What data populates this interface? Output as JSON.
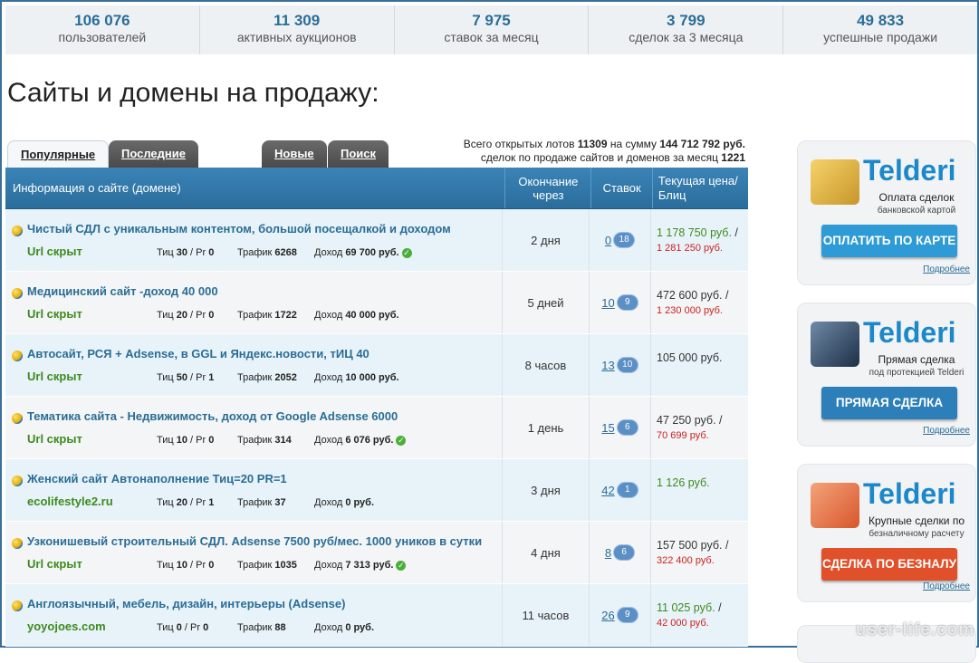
{
  "stats": [
    {
      "num": "106 076",
      "label": "пользователей"
    },
    {
      "num": "11 309",
      "label": "активных аукционов"
    },
    {
      "num": "7 975",
      "label": "ставок за месяц"
    },
    {
      "num": "3 799",
      "label": "сделок за 3 месяца"
    },
    {
      "num": "49 833",
      "label": "успешные продажи"
    }
  ],
  "page_title": "Сайты и домены на продажу:",
  "tabs": [
    {
      "label": "Популярные",
      "active": true
    },
    {
      "label": "Последние активные"
    },
    {
      "label": "Новые"
    },
    {
      "label": "Поиск"
    }
  ],
  "totals": {
    "line1_prefix": "Всего открытых лотов ",
    "lots": "11309",
    "line1_mid": " на сумму ",
    "sum": "144 712 792 руб.",
    "line2_prefix": "сделок по продаже сайтов и доменов за месяц ",
    "deals": "1221"
  },
  "table": {
    "headers": {
      "info": "Информация о сайте (домене)",
      "end": "Окончание через",
      "bids": "Ставок",
      "price": "Текущая цена/Блиц"
    },
    "rows": [
      {
        "title": "Чистый СДЛ с уникальным контентом, большой посещалкой и доходом",
        "site": "Url скрыт",
        "tic": "30",
        "pr": "0",
        "traffic": "6268",
        "income": "69 700 руб.",
        "verified": true,
        "end": "2 дня",
        "bids": "0",
        "bubble": "18",
        "price": "1 178 750 руб.",
        "sep": "/",
        "blitz": "1 281 250 руб."
      },
      {
        "title": "Медицинский сайт -доход 40 000",
        "site": "Url скрыт",
        "tic": "20",
        "pr": "0",
        "traffic": "1722",
        "income": "40 000 руб.",
        "verified": false,
        "end": "5 дней",
        "bids": "10",
        "bubble": "9",
        "price": "472 600 руб.",
        "sep": "/",
        "blitz": "1 230 000 руб."
      },
      {
        "title": "Автосайт, РСЯ + Adsense, в GGL и Яндекс.новости, тИЦ 40",
        "site": "Url скрыт",
        "tic": "50",
        "pr": "1",
        "traffic": "2052",
        "income": "10 000 руб.",
        "verified": false,
        "end": "8 часов",
        "bids": "13",
        "bubble": "10",
        "price": "105 000 руб.",
        "sep": "",
        "blitz": ""
      },
      {
        "title": "Тематика сайта - Недвижимость, доход от Google Adsense 6000",
        "site": "Url скрыт",
        "tic": "10",
        "pr": "0",
        "traffic": "314",
        "income": "6 076 руб.",
        "verified": true,
        "end": "1 день",
        "bids": "15",
        "bubble": "6",
        "price": "47 250 руб.",
        "sep": "/",
        "blitz": "70 699 руб."
      },
      {
        "title": "Женский сайт Автонаполнение Тиц=20 PR=1",
        "site": "ecolifestyle2.ru",
        "tic": "20",
        "pr": "1",
        "traffic": "37",
        "income": "0 руб.",
        "verified": false,
        "end": "3 дня",
        "bids": "42",
        "bubble": "1",
        "price": "1 126 руб.",
        "sep": "",
        "blitz": ""
      },
      {
        "title": "Узконишевый строительный СДЛ. Adsense 7500 руб/мес. 1000 уников в сутки",
        "site": "Url скрыт",
        "tic": "10",
        "pr": "0",
        "traffic": "1035",
        "income": "7 313 руб.",
        "verified": true,
        "end": "4 дня",
        "bids": "8",
        "bubble": "6",
        "price": "157 500 руб.",
        "sep": "/",
        "blitz": "322 400 руб."
      },
      {
        "title": "Англоязычный, мебель, дизайн, интерьеры (Adsense)",
        "site": "yoyojoes.com",
        "tic": "0",
        "pr": "0",
        "traffic": "88",
        "income": "0 руб.",
        "verified": false,
        "end": "11 часов",
        "bids": "26",
        "bubble": "9",
        "price": "11 025 руб.",
        "sep": "/",
        "blitz": "42 000 руб."
      }
    ],
    "labels": {
      "tic": "Тиц",
      "pr": "Pr",
      "traffic": "Трафик",
      "income": "Доход"
    }
  },
  "ads": [
    {
      "brand": "Telderi",
      "line1": "Оплата сделок",
      "line2": "банковской картой",
      "button": "ОПЛАТИТЬ ПО КАРТЕ",
      "more": "Подробнее",
      "btn_color": "#2f9bd6",
      "icon": "credit-card-icon"
    },
    {
      "brand": "Telderi",
      "line1": "Прямая сделка",
      "line2": "под протекцией Telderi",
      "button": "ПРЯМАЯ СДЕЛКА",
      "more": "Подробнее",
      "btn_color": "#2c7fb8",
      "icon": "shield-icon"
    },
    {
      "brand": "Telderi",
      "line1": "Крупные сделки по",
      "line2": "безналичному расчету",
      "button": "СДЕЛКА ПО БЕЗНАЛУ",
      "more": "Подробнее",
      "btn_color": "#e0502a",
      "icon": "building-icon"
    }
  ],
  "watermark": "user-life.com",
  "colors": {
    "accent": "#2a6d96",
    "green": "#3d8a1f",
    "red": "#cc1f1f",
    "header": "#2f78aa"
  }
}
